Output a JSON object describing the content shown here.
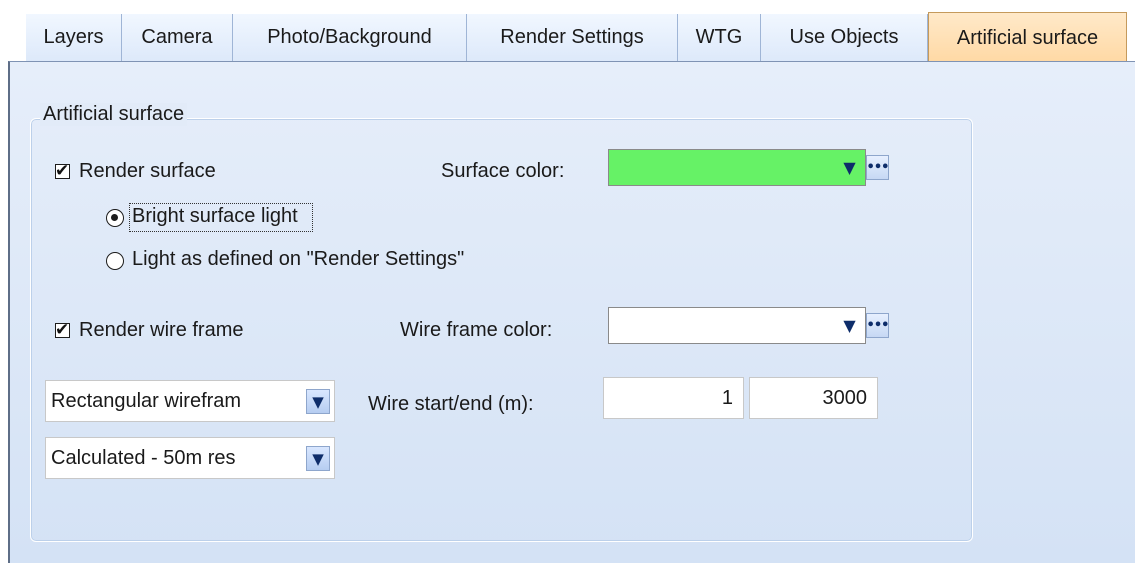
{
  "tabs": [
    {
      "label": "Layers"
    },
    {
      "label": "Camera"
    },
    {
      "label": "Photo/Background"
    },
    {
      "label": "Render Settings"
    },
    {
      "label": "WTG"
    },
    {
      "label": "Use Objects"
    },
    {
      "label": "Artificial surface",
      "active": true
    }
  ],
  "group": {
    "title": "Artificial surface"
  },
  "render_surface": {
    "label": "Render surface",
    "checked": true
  },
  "surface_color": {
    "label": "Surface color:",
    "value": "#66f266"
  },
  "light_options": [
    {
      "label": "Bright surface light",
      "selected": true
    },
    {
      "label": "Light as defined on \"Render Settings\"",
      "selected": false
    }
  ],
  "render_wire_frame": {
    "label": "Render wire frame",
    "checked": true
  },
  "wire_frame_color": {
    "label": "Wire frame color:",
    "value": "#ffffff"
  },
  "wireframe_type": {
    "value": "Rectangular wirefram"
  },
  "resolution": {
    "value": "Calculated - 50m res"
  },
  "wire_start_end": {
    "label": "Wire start/end (m):",
    "start": "1",
    "end": "3000"
  },
  "icons": {
    "dropdown": "▼",
    "ellipsis": "•••",
    "check": "✔"
  }
}
